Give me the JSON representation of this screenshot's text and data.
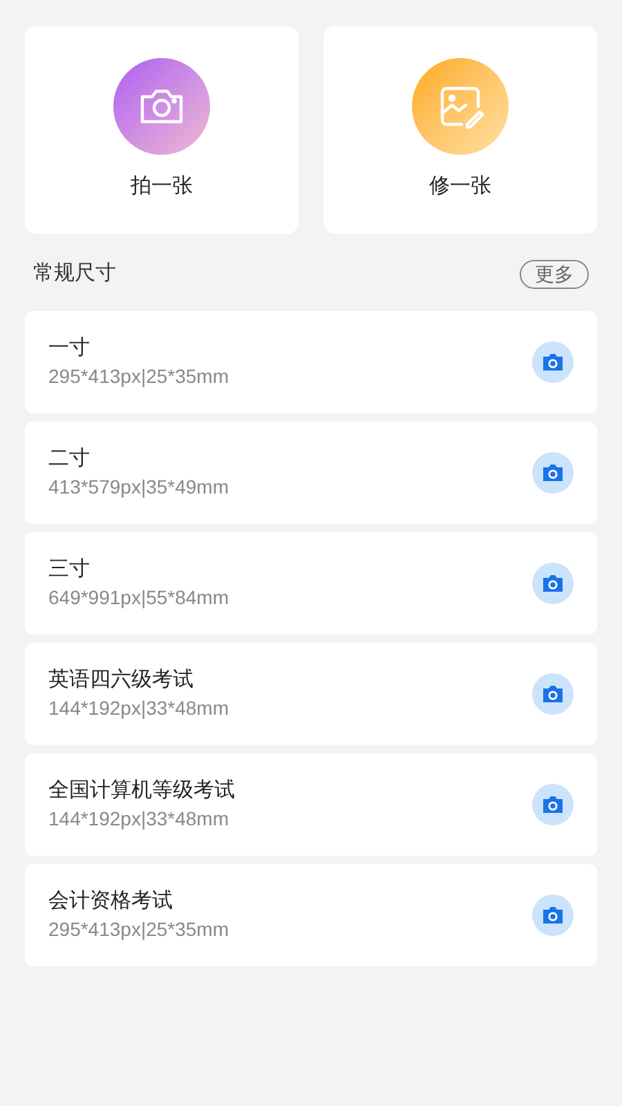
{
  "actions": [
    {
      "kind": "camera",
      "label": "拍一张"
    },
    {
      "kind": "edit",
      "label": "修一张"
    }
  ],
  "section": {
    "title": "常规尺寸",
    "more": "更多"
  },
  "sizes": [
    {
      "name": "一寸",
      "spec": "295*413px|25*35mm"
    },
    {
      "name": "二寸",
      "spec": "413*579px|35*49mm"
    },
    {
      "name": "三寸",
      "spec": "649*991px|55*84mm"
    },
    {
      "name": "英语四六级考试",
      "spec": "144*192px|33*48mm"
    },
    {
      "name": "全国计算机等级考试",
      "spec": "144*192px|33*48mm"
    },
    {
      "name": "会计资格考试",
      "spec": "295*413px|25*35mm"
    }
  ]
}
